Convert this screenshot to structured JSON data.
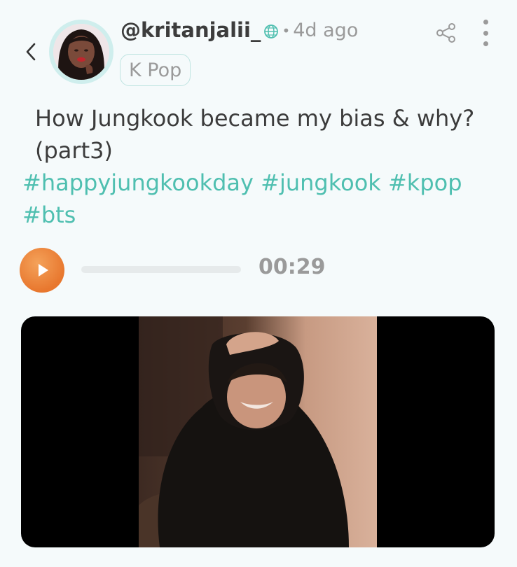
{
  "header": {
    "back_icon": "chevron-left-icon",
    "username": "@kritanjalii_",
    "globe_icon": "globe-icon",
    "separator": "•",
    "timestamp": "4d ago",
    "community": "K Pop",
    "share_icon": "share-icon",
    "more_icon": "more-vertical-icon"
  },
  "post": {
    "title": "How Jungkook became my bias & why?(part3)",
    "hashtags": [
      "#happyjungkookday",
      "#jungkook",
      "#kpop",
      "#bts"
    ]
  },
  "audio": {
    "play_icon": "play-icon",
    "progress": 0,
    "duration": "00:29"
  },
  "colors": {
    "accent": "#4fbfb0",
    "audio_button": "#e8772e",
    "background": "#f5fafb"
  }
}
